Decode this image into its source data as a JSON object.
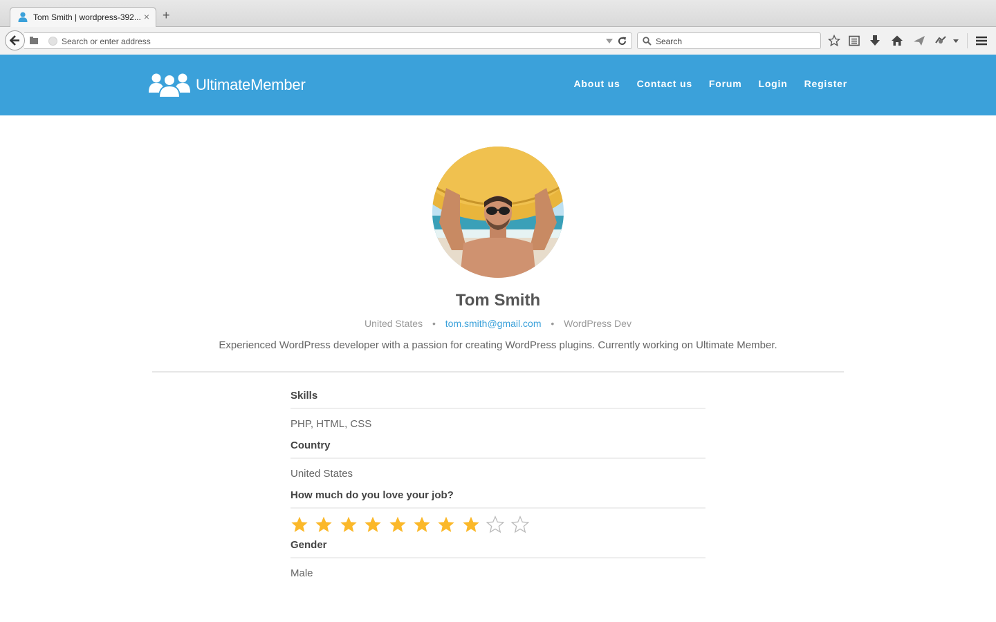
{
  "browser": {
    "tab_title": "Tom Smith | wordpress-392...",
    "tab_close": "×",
    "new_tab": "+",
    "url_placeholder": "Search or enter address",
    "search_placeholder": "Search"
  },
  "site": {
    "logo_text": "UltimateMember",
    "brand_color": "#3ba1da",
    "nav": [
      "About us",
      "Contact us",
      "Forum",
      "Login",
      "Register"
    ]
  },
  "profile": {
    "name": "Tom Smith",
    "country": "United States",
    "email": "tom.smith@gmail.com",
    "role": "WordPress Dev",
    "separator": "•",
    "bio": "Experienced WordPress developer with a passion for creating WordPress plugins. Currently working on Ultimate Member."
  },
  "fields": {
    "skills": {
      "label": "Skills",
      "value": "PHP, HTML, CSS"
    },
    "country": {
      "label": "Country",
      "value": "United States"
    },
    "job_love": {
      "label": "How much do you love your job?",
      "rating": 8,
      "max": 10,
      "star_color": "#fbb829"
    },
    "gender": {
      "label": "Gender",
      "value": "Male"
    }
  }
}
